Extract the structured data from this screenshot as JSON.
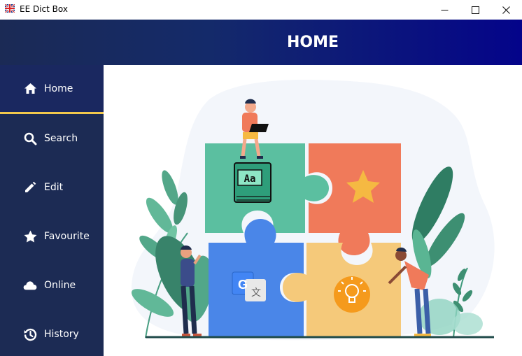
{
  "window": {
    "title": "EE Dict Box"
  },
  "header": {
    "title": "HOME"
  },
  "sidebar": {
    "items": [
      {
        "label": "Home",
        "icon": "home-icon",
        "active": true
      },
      {
        "label": "Search",
        "icon": "search-icon",
        "active": false
      },
      {
        "label": "Edit",
        "icon": "pencil-icon",
        "active": false
      },
      {
        "label": "Favourite",
        "icon": "star-icon",
        "active": false
      },
      {
        "label": "Online",
        "icon": "cloud-icon",
        "active": false
      },
      {
        "label": "History",
        "icon": "history-icon",
        "active": false
      }
    ]
  },
  "illustration": {
    "book_label": "Aa",
    "translate_label": "G",
    "translate_char": "文"
  },
  "colors": {
    "header_start": "#1b2a55",
    "header_end": "#04048a",
    "sidebar": "#1c2b54",
    "active_underline": "#f2c94c",
    "puzzle_green": "#5bbfa0",
    "puzzle_orange": "#f07a5a",
    "puzzle_blue": "#4a86e8",
    "puzzle_yellow": "#f5c97a"
  }
}
